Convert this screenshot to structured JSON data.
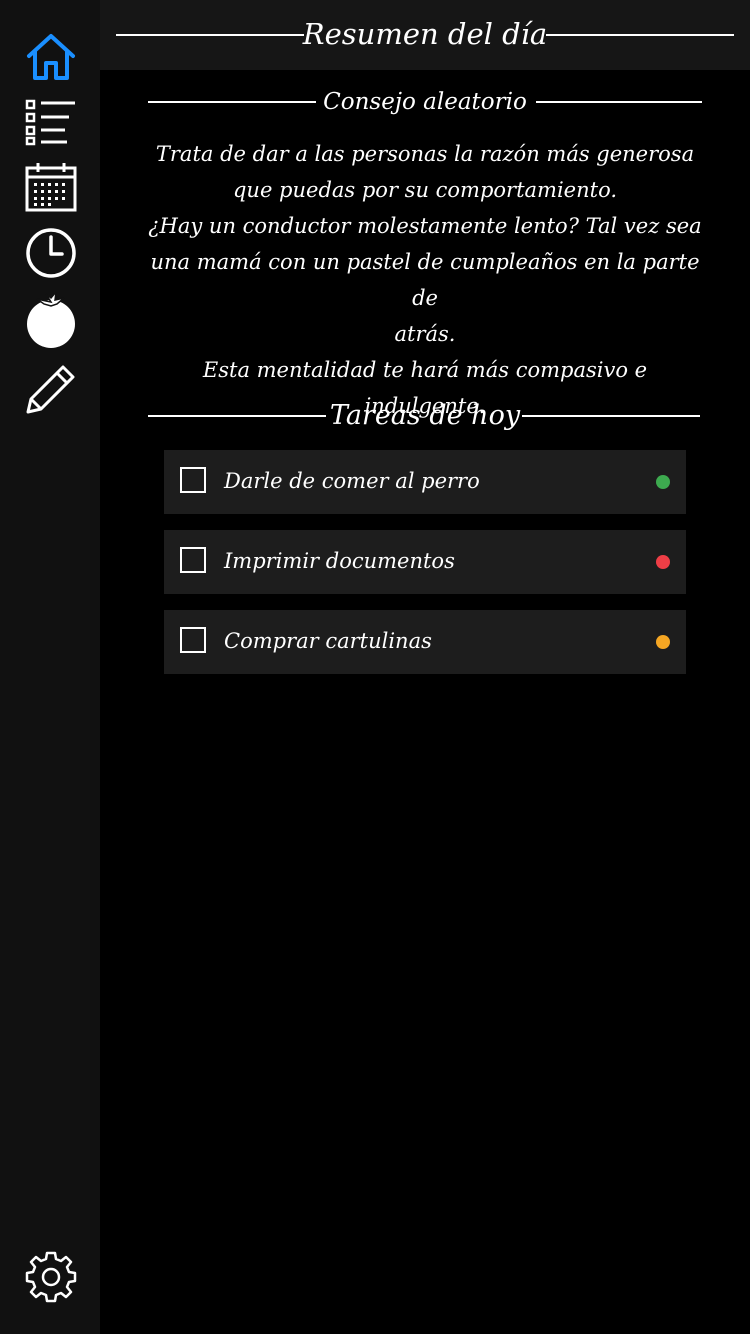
{
  "header": {
    "title": "Resumen del día"
  },
  "sidebar": {
    "items": [
      {
        "icon": "home-icon",
        "active": true,
        "color": "#1a8fff"
      },
      {
        "icon": "list-icon"
      },
      {
        "icon": "calendar-icon"
      },
      {
        "icon": "clock-icon"
      },
      {
        "icon": "tomato-icon"
      },
      {
        "icon": "pencil-icon"
      }
    ],
    "bottom": {
      "icon": "gear-icon"
    }
  },
  "tip_section": {
    "title": "Consejo aleatorio",
    "lines": [
      "Trata de dar a las personas la razón más generosa",
      "que puedas por su comportamiento.",
      "¿Hay un conductor molestamente lento? Tal vez sea",
      "una mamá con un pastel de cumpleaños en la parte de",
      "atrás.",
      "Esta mentalidad te hará más compasivo e indulgente."
    ]
  },
  "tasks_section": {
    "title": "Tareas de hoy",
    "tasks": [
      {
        "label": "Darle de comer al perro",
        "checked": false,
        "priority_color": "#3daa4f"
      },
      {
        "label": "Imprimir documentos",
        "checked": false,
        "priority_color": "#ee3e46"
      },
      {
        "label": "Comprar cartulinas",
        "checked": false,
        "priority_color": "#f5a623"
      }
    ]
  }
}
